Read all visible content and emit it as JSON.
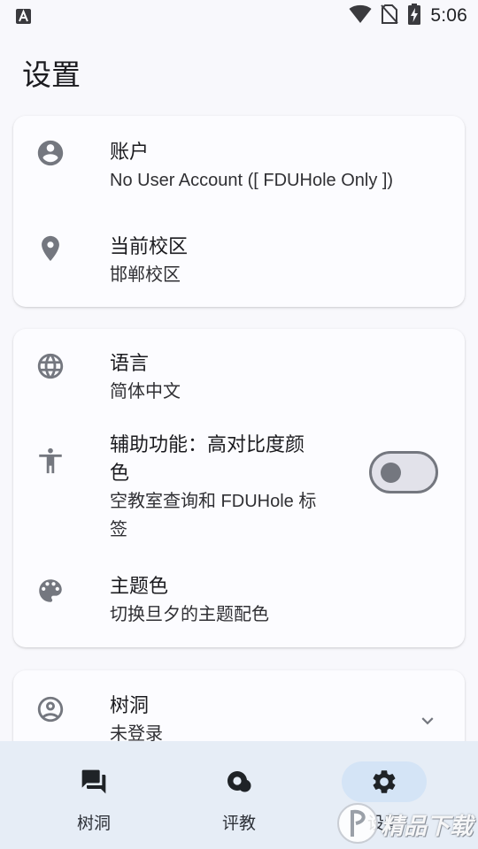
{
  "status_bar": {
    "time": "5:06",
    "icons": [
      "app-notification-icon",
      "wifi-icon",
      "no-sim-icon",
      "battery-charging-icon"
    ]
  },
  "page": {
    "title": "设置"
  },
  "account_card": {
    "account": {
      "title": "账户",
      "subtitle": "No User Account ([ FDUHole Only ])",
      "icon": "account-circle-icon"
    },
    "campus": {
      "title": "当前校区",
      "subtitle": "邯郸校区",
      "icon": "location-pin-icon"
    }
  },
  "preferences_card": {
    "language": {
      "title": "语言",
      "subtitle": "简体中文",
      "icon": "globe-icon"
    },
    "accessibility": {
      "title_line1": "辅助功能：高对比度颜",
      "title_line2": "色",
      "subtitle_line1": "空教室查询和 FDUHole 标",
      "subtitle_line2": "签",
      "icon": "accessibility-icon",
      "toggle_on": false
    },
    "theme": {
      "title": "主题色",
      "subtitle": "切换旦夕的主题配色",
      "icon": "palette-icon"
    }
  },
  "treehole_card": {
    "title": "树洞",
    "subtitle": "未登录",
    "icon": "account-outline-icon",
    "expand_icon": "chevron-down-icon"
  },
  "bottom_nav": {
    "selected": "settings",
    "items": [
      {
        "id": "treehole",
        "label": "树洞",
        "icon": "forum-icon"
      },
      {
        "id": "review",
        "label": "评教",
        "icon": "review-icon"
      },
      {
        "id": "settings",
        "label": "设置",
        "icon": "gear-icon"
      }
    ]
  },
  "watermark": {
    "text": "精品下载"
  },
  "colors": {
    "background": "#f8f8fc",
    "card": "#fcfcff",
    "icon": "#74777f",
    "nav_background": "#e6edf6",
    "nav_indicator": "#d4e4f6",
    "text": "#1b1b1f"
  }
}
